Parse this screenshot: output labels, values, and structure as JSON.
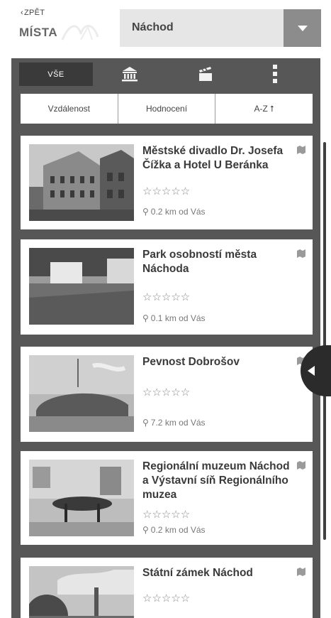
{
  "header": {
    "back_label": "ZPĚT",
    "title": "MÍSTA",
    "city_selected": "Náchod"
  },
  "filters": {
    "all_label": "VŠE",
    "icons": [
      "museum-icon",
      "cinema-clapper-icon",
      "more-vertical-icon"
    ]
  },
  "sort": {
    "distance": "Vzdálenost",
    "rating": "Hodnocení",
    "az": "A-Z ⭡"
  },
  "places": [
    {
      "name": "Městské divadlo Dr. Josefa Čížka a Hotel U Beránka",
      "rating_stars": "☆☆☆☆☆",
      "distance": "0.2 km od Vás"
    },
    {
      "name": "Park osobností města Náchoda",
      "rating_stars": "☆☆☆☆☆",
      "distance": "0.1 km od Vás"
    },
    {
      "name": "Pevnost Dobrošov",
      "rating_stars": "☆☆☆☆☆",
      "distance": "7.2 km od Vás"
    },
    {
      "name": "Regionální muzeum Náchod a Výstavní síň Regionálního muzea",
      "rating_stars": "☆☆☆☆☆",
      "distance": "0.2 km od Vás"
    },
    {
      "name": "Státní zámek Náchod",
      "rating_stars": "☆☆☆☆☆",
      "distance": ""
    }
  ],
  "colors": {
    "panel": "#575757",
    "active_tab": "#3a3a3a",
    "select_bg": "#e6e6e6",
    "select_button": "#8c8c8c"
  }
}
